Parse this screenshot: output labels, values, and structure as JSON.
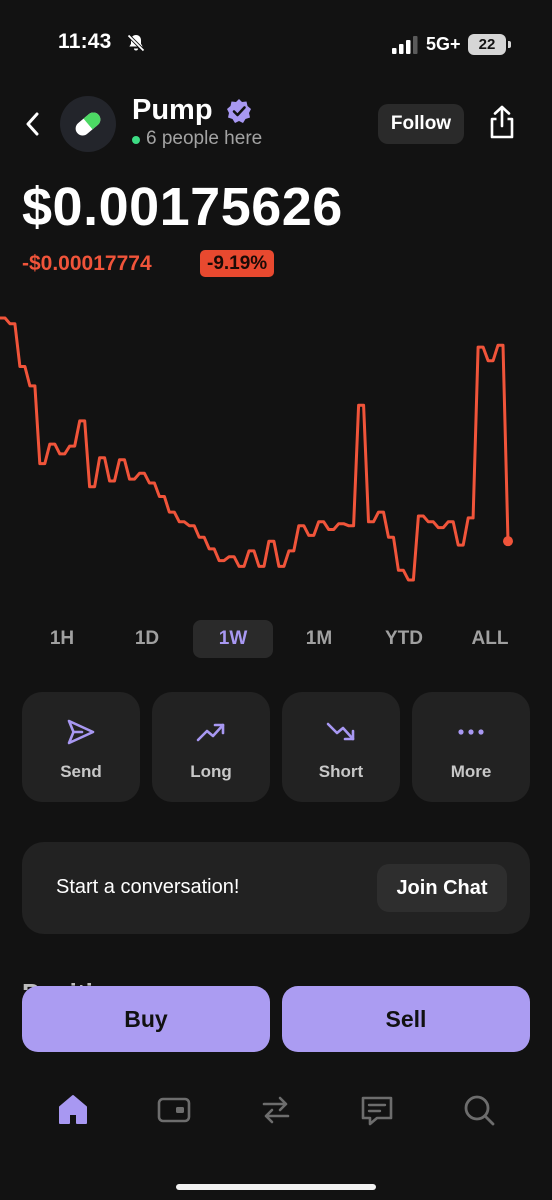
{
  "status_bar": {
    "time": "11:43",
    "network": "5G+",
    "battery": "22"
  },
  "header": {
    "token_name": "Pump",
    "presence": "6 people here",
    "follow_label": "Follow"
  },
  "price": {
    "value": "$0.00175626",
    "change": "-$0.00017774",
    "change_pct": "-9.19%"
  },
  "colors": {
    "accent": "#ab9cf2",
    "negative": "#f0543a",
    "background": "#121212",
    "card": "#222222"
  },
  "chart_data": {
    "type": "line",
    "color": "#f0543a",
    "y_axis_shown": false,
    "x_axis_shown": false,
    "values": [
      0.95,
      0.95,
      0.92,
      0.92,
      0.7,
      0.7,
      0.6,
      0.6,
      0.2,
      0.2,
      0.3,
      0.3,
      0.25,
      0.25,
      0.29,
      0.29,
      0.42,
      0.42,
      0.08,
      0.08,
      0.23,
      0.23,
      0.11,
      0.11,
      0.22,
      0.22,
      0.12,
      0.12,
      0.15,
      0.15,
      0.1,
      0.1,
      0.03,
      0.03,
      -0.05,
      -0.05,
      -0.1,
      -0.1,
      -0.12,
      -0.12,
      -0.18,
      -0.18,
      -0.24,
      -0.24,
      -0.3,
      -0.3,
      -0.28,
      -0.28,
      -0.33,
      -0.33,
      -0.25,
      -0.25,
      -0.33,
      -0.33,
      -0.2,
      -0.2,
      -0.33,
      -0.33,
      -0.25,
      -0.25,
      -0.12,
      -0.12,
      -0.17,
      -0.17,
      -0.1,
      -0.1,
      -0.14,
      -0.14,
      -0.11,
      -0.11,
      -0.12,
      -0.12,
      0.5,
      0.5,
      -0.1,
      -0.1,
      -0.05,
      -0.05,
      -0.18,
      -0.18,
      -0.35,
      -0.35,
      -0.4,
      -0.4,
      -0.07,
      -0.07,
      -0.1,
      -0.1,
      -0.13,
      -0.13,
      -0.1,
      -0.1,
      -0.22,
      -0.22,
      -0.08,
      -0.08,
      0.8,
      0.8,
      0.73,
      0.73,
      0.81,
      0.81,
      -0.2
    ]
  },
  "time_ranges": [
    "1H",
    "1D",
    "1W",
    "1M",
    "YTD",
    "ALL"
  ],
  "active_range": "1W",
  "actions": [
    {
      "label": "Send",
      "icon": "send-icon"
    },
    {
      "label": "Long",
      "icon": "trend-up-icon"
    },
    {
      "label": "Short",
      "icon": "trend-down-icon"
    },
    {
      "label": "More",
      "icon": "more-icon"
    }
  ],
  "conversation": {
    "prompt": "Start a conversation!",
    "join_label": "Join Chat"
  },
  "positions_peek": "Positi",
  "trade": {
    "buy_label": "Buy",
    "sell_label": "Sell"
  },
  "tabbar": [
    {
      "icon": "home-icon",
      "active": true
    },
    {
      "icon": "wallet-icon",
      "active": false
    },
    {
      "icon": "swap-icon",
      "active": false
    },
    {
      "icon": "chat-icon",
      "active": false
    },
    {
      "icon": "search-icon",
      "active": false
    }
  ]
}
